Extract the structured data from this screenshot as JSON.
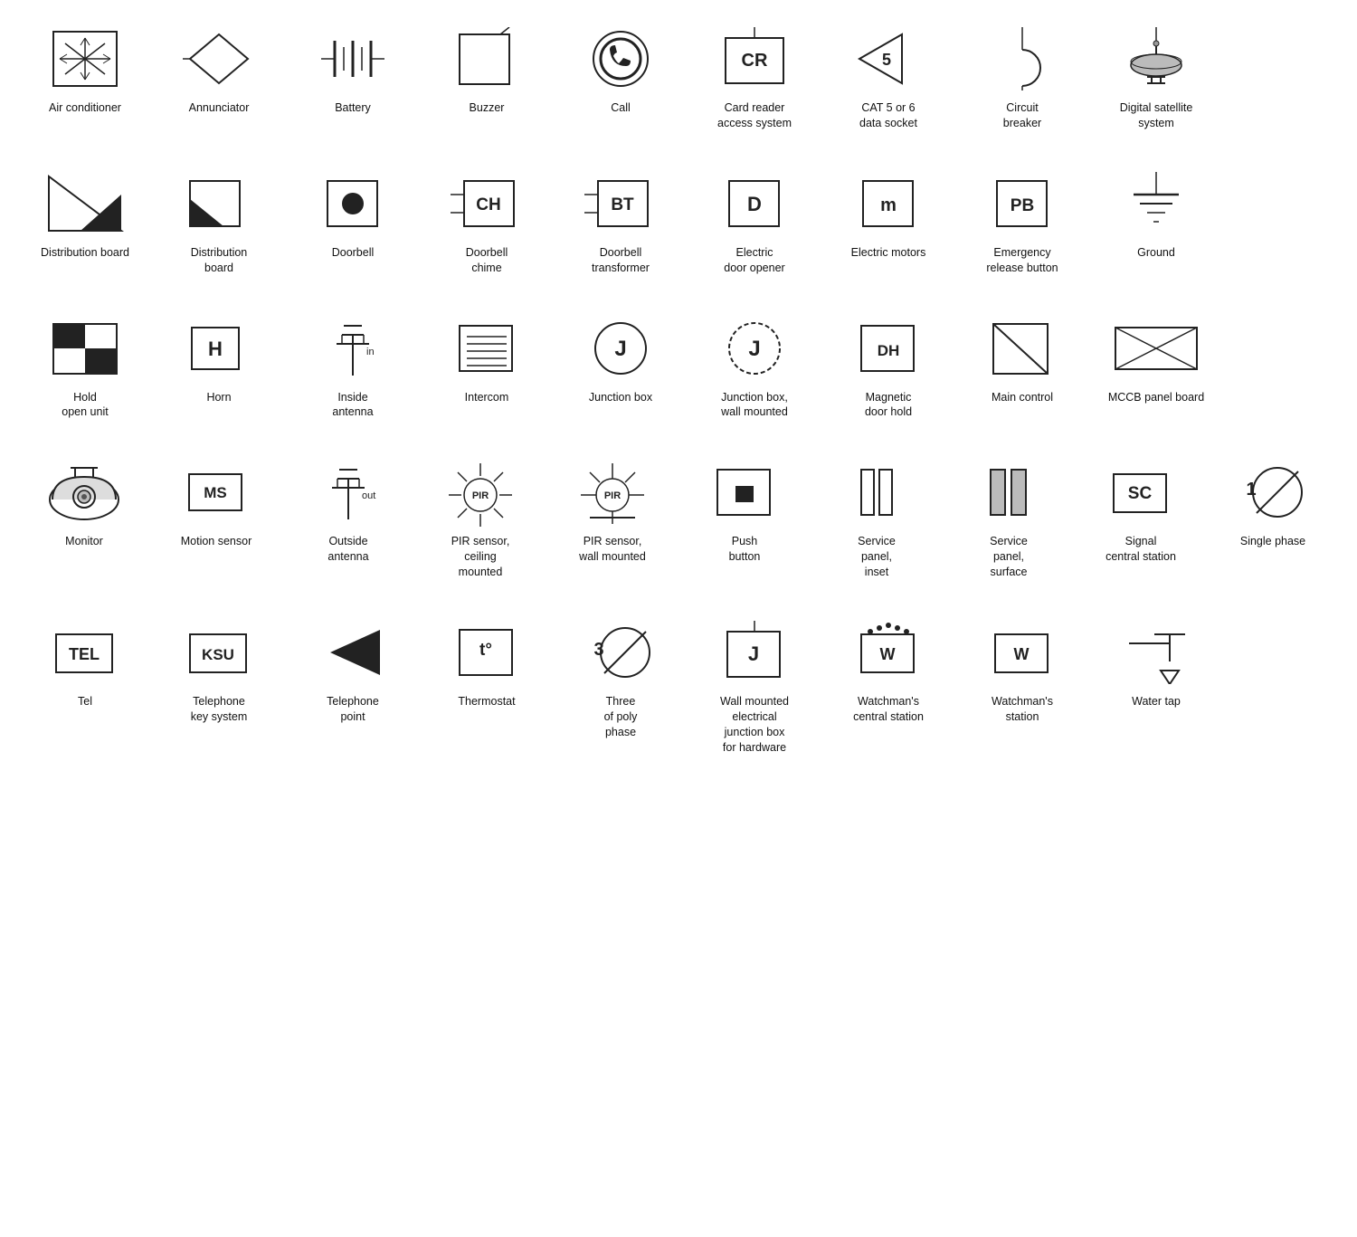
{
  "rows": [
    {
      "items": [
        {
          "id": "air-conditioner",
          "label": "Air conditioner"
        },
        {
          "id": "annunciator",
          "label": "Annunciator"
        },
        {
          "id": "battery",
          "label": "Battery"
        },
        {
          "id": "buzzer",
          "label": "Buzzer"
        },
        {
          "id": "call",
          "label": "Call"
        },
        {
          "id": "card-reader",
          "label": "Card reader\naccess system"
        },
        {
          "id": "cat56",
          "label": "CAT 5 or 6\ndata socket"
        },
        {
          "id": "circuit-breaker",
          "label": "Circuit\nbreaker"
        },
        {
          "id": "digital-satellite",
          "label": "Digital satellite\nsystem"
        }
      ]
    },
    {
      "items": [
        {
          "id": "distribution-board-1",
          "label": "Distribution board"
        },
        {
          "id": "distribution-board-2",
          "label": "Distribution\nboard"
        },
        {
          "id": "doorbell",
          "label": "Doorbell"
        },
        {
          "id": "doorbell-chime",
          "label": "Doorbell\nchime"
        },
        {
          "id": "doorbell-transformer",
          "label": "Doorbell\ntransformer"
        },
        {
          "id": "electric-door-opener",
          "label": "Electric\ndoor opener"
        },
        {
          "id": "electric-motors",
          "label": "Electric motors"
        },
        {
          "id": "emergency-release",
          "label": "Emergency\nrelease button"
        },
        {
          "id": "ground",
          "label": "Ground"
        }
      ]
    },
    {
      "items": [
        {
          "id": "hold-open-unit",
          "label": "Hold\nopen unit"
        },
        {
          "id": "horn",
          "label": "Horn"
        },
        {
          "id": "inside-antenna",
          "label": "Inside\nantenna"
        },
        {
          "id": "intercom",
          "label": "Intercom"
        },
        {
          "id": "junction-box",
          "label": "Junction box"
        },
        {
          "id": "junction-box-wall",
          "label": "Junction box,\nwall mounted"
        },
        {
          "id": "magnetic-door-hold",
          "label": "Magnetic\ndoor hold"
        },
        {
          "id": "main-control",
          "label": "Main control"
        },
        {
          "id": "mccb-panel",
          "label": "MCCB panel board"
        }
      ]
    },
    {
      "items": [
        {
          "id": "monitor",
          "label": "Monitor"
        },
        {
          "id": "motion-sensor",
          "label": "Motion sensor"
        },
        {
          "id": "outside-antenna",
          "label": "Outside\nantenna"
        },
        {
          "id": "pir-ceiling",
          "label": "PIR sensor,\nceiling\nmounted"
        },
        {
          "id": "pir-wall",
          "label": "PIR sensor,\nwall mounted"
        },
        {
          "id": "push-button",
          "label": "Push\nbutton"
        },
        {
          "id": "service-panel-inset",
          "label": "Service\npanel,\ninset"
        },
        {
          "id": "service-panel-surface",
          "label": "Service\npanel,\nsurface"
        },
        {
          "id": "signal-central",
          "label": "Signal\ncentral station"
        },
        {
          "id": "single-phase",
          "label": "Single phase"
        }
      ]
    },
    {
      "items": [
        {
          "id": "tel",
          "label": "Tel"
        },
        {
          "id": "telephone-key",
          "label": "Telephone\nkey system"
        },
        {
          "id": "telephone-point",
          "label": "Telephone\npoint"
        },
        {
          "id": "thermostat",
          "label": "Thermostat"
        },
        {
          "id": "three-poly",
          "label": "Three\nof poly\nphase"
        },
        {
          "id": "wall-junction",
          "label": "Wall mounted\nelectrical\njunction box\nfor hardware"
        },
        {
          "id": "watchman-central",
          "label": "Watchman's\ncentral station"
        },
        {
          "id": "watchman-station",
          "label": "Watchman's\nstation"
        },
        {
          "id": "water-tap",
          "label": "Water tap"
        }
      ]
    }
  ]
}
